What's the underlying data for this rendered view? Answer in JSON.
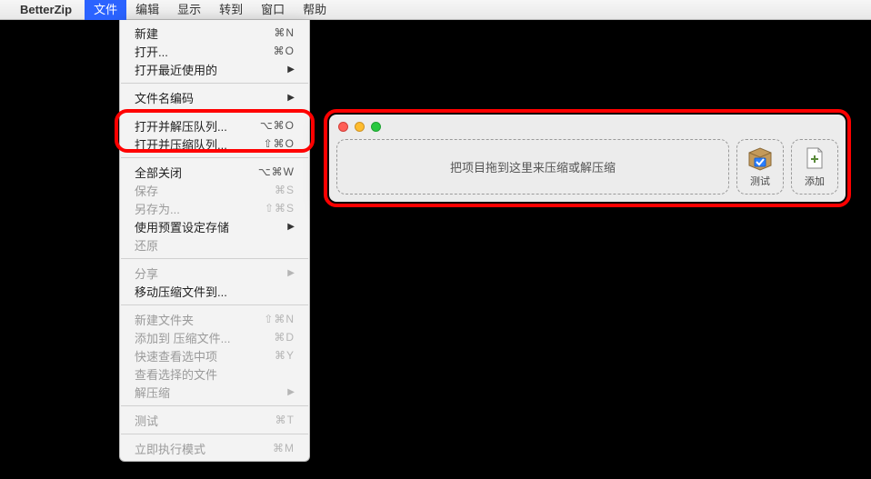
{
  "menubar": {
    "app_name": "BetterZip",
    "items": [
      "文件",
      "编辑",
      "显示",
      "转到",
      "窗口",
      "帮助"
    ],
    "active_index": 0
  },
  "dropdown": {
    "groups": [
      [
        {
          "label": "新建",
          "shortcut": "⌘N",
          "disabled": false,
          "submenu": false
        },
        {
          "label": "打开...",
          "shortcut": "⌘O",
          "disabled": false,
          "submenu": false
        },
        {
          "label": "打开最近使用的",
          "shortcut": "",
          "disabled": false,
          "submenu": true
        }
      ],
      [
        {
          "label": "文件名编码",
          "shortcut": "",
          "disabled": false,
          "submenu": true
        }
      ],
      [
        {
          "label": "打开并解压队列...",
          "shortcut": "⌥⌘O",
          "disabled": false,
          "submenu": false
        },
        {
          "label": "打开并压缩队列...",
          "shortcut": "⇧⌘O",
          "disabled": false,
          "submenu": false
        }
      ],
      [
        {
          "label": "全部关闭",
          "shortcut": "⌥⌘W",
          "disabled": false,
          "submenu": false
        },
        {
          "label": "保存",
          "shortcut": "⌘S",
          "disabled": true,
          "submenu": false
        },
        {
          "label": "另存为...",
          "shortcut": "⇧⌘S",
          "disabled": true,
          "submenu": false
        },
        {
          "label": "使用预置设定存储",
          "shortcut": "",
          "disabled": false,
          "submenu": true
        },
        {
          "label": "还原",
          "shortcut": "",
          "disabled": true,
          "submenu": false
        }
      ],
      [
        {
          "label": "分享",
          "shortcut": "",
          "disabled": true,
          "submenu": true
        },
        {
          "label": "移动压缩文件到...",
          "shortcut": "",
          "disabled": false,
          "submenu": false
        }
      ],
      [
        {
          "label": "新建文件夹",
          "shortcut": "⇧⌘N",
          "disabled": true,
          "submenu": false
        },
        {
          "label": "添加到 压缩文件...",
          "shortcut": "⌘D",
          "disabled": true,
          "submenu": false
        },
        {
          "label": "快速查看选中项",
          "shortcut": "⌘Y",
          "disabled": true,
          "submenu": false
        },
        {
          "label": "查看选择的文件",
          "shortcut": "",
          "disabled": true,
          "submenu": false
        },
        {
          "label": "解压缩",
          "shortcut": "",
          "disabled": true,
          "submenu": true
        }
      ],
      [
        {
          "label": "测试",
          "shortcut": "⌘T",
          "disabled": true,
          "submenu": false
        }
      ],
      [
        {
          "label": "立即执行模式",
          "shortcut": "⌘M",
          "disabled": true,
          "submenu": false
        }
      ]
    ]
  },
  "window": {
    "dropzone_text": "把项目拖到这里来压缩或解压缩",
    "buttons": {
      "test": "测试",
      "add": "添加"
    }
  }
}
